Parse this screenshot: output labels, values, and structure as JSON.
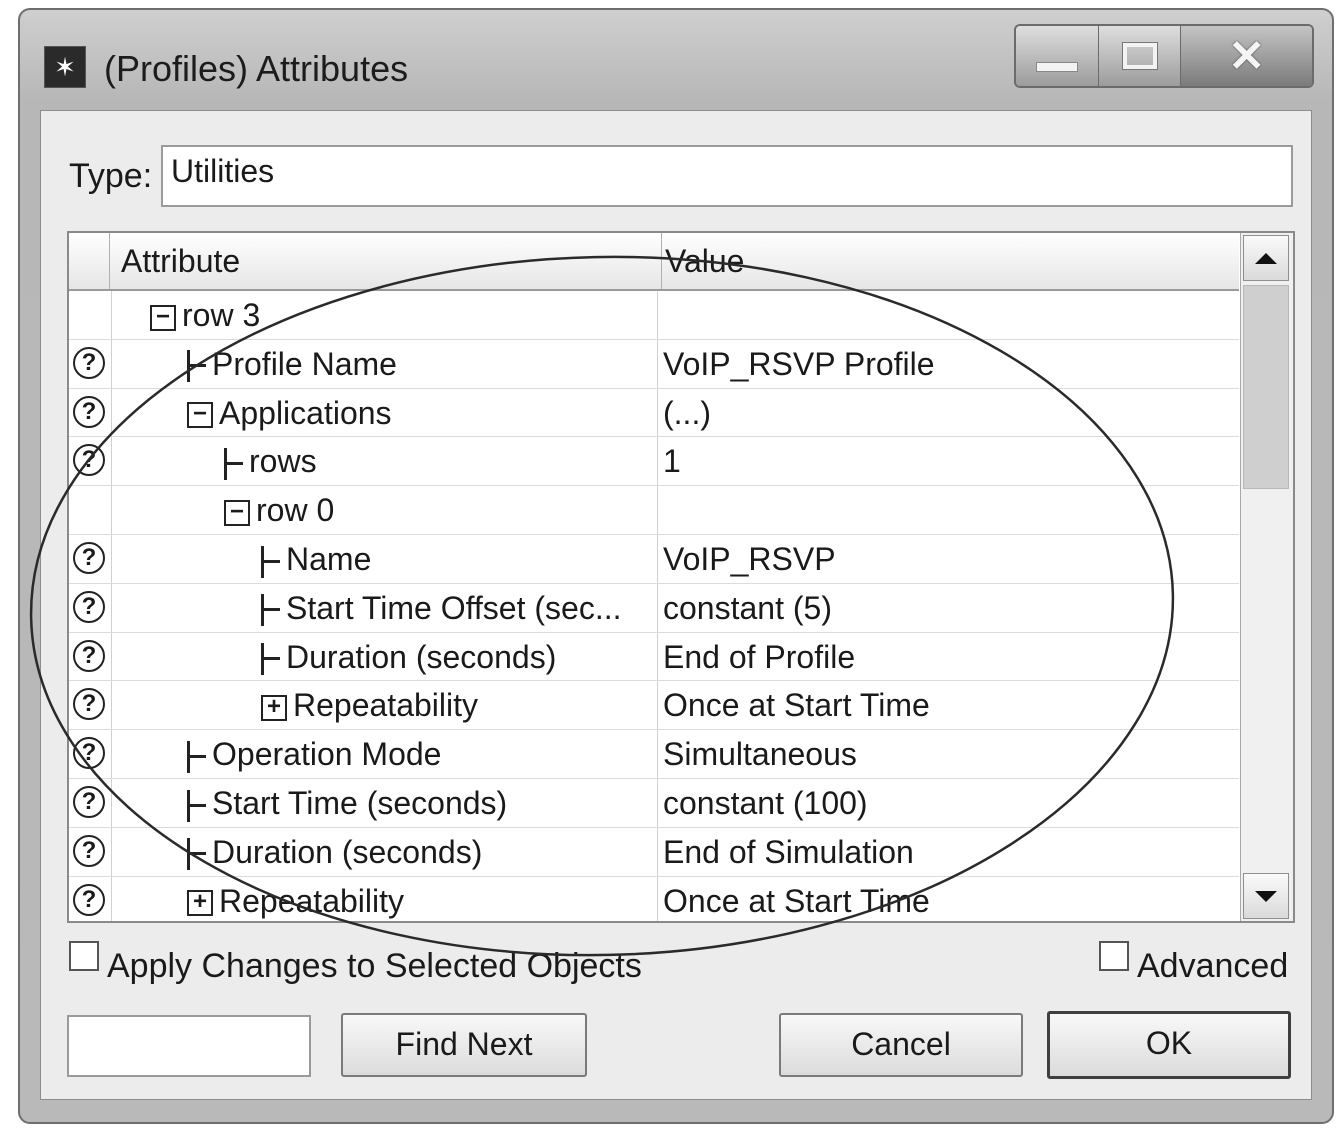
{
  "window": {
    "title": "(Profiles) Attributes",
    "icon": "app-star-icon",
    "controls": [
      "minimize-icon",
      "maximize-icon",
      "close-icon"
    ]
  },
  "type": {
    "label": "Type:",
    "value": "Utilities"
  },
  "grid": {
    "columns": {
      "attribute": "Attribute",
      "value": "Value"
    },
    "rows": [
      {
        "attr": "row 3",
        "value": "",
        "help": false,
        "expander": "−",
        "connector": false,
        "indent": 1
      },
      {
        "attr": "Profile Name",
        "value": "VoIP_RSVP Profile",
        "help": true,
        "expander": "",
        "connector": true,
        "indent": 2
      },
      {
        "attr": "Applications",
        "value": "(...)",
        "help": true,
        "expander": "−",
        "connector": false,
        "indent": 2
      },
      {
        "attr": "rows",
        "value": "1",
        "help": true,
        "expander": "",
        "connector": true,
        "indent": 3
      },
      {
        "attr": "row 0",
        "value": "",
        "help": false,
        "expander": "−",
        "connector": false,
        "indent": 3
      },
      {
        "attr": "Name",
        "value": "VoIP_RSVP",
        "help": true,
        "expander": "",
        "connector": true,
        "indent": 4
      },
      {
        "attr": "Start Time Offset (sec...",
        "value": "constant (5)",
        "help": true,
        "expander": "",
        "connector": true,
        "indent": 4
      },
      {
        "attr": "Duration (seconds)",
        "value": "End of Profile",
        "help": true,
        "expander": "",
        "connector": true,
        "indent": 4
      },
      {
        "attr": "Repeatability",
        "value": "Once at Start Time",
        "help": true,
        "expander": "+",
        "connector": false,
        "indent": 4
      },
      {
        "attr": "Operation Mode",
        "value": "Simultaneous",
        "help": true,
        "expander": "",
        "connector": true,
        "indent": 2
      },
      {
        "attr": "Start Time (seconds)",
        "value": "constant (100)",
        "help": true,
        "expander": "",
        "connector": true,
        "indent": 2
      },
      {
        "attr": "Duration (seconds)",
        "value": "End of Simulation",
        "help": true,
        "expander": "",
        "connector": true,
        "indent": 2
      },
      {
        "attr": "Repeatability",
        "value": "Once at Start Time",
        "help": true,
        "expander": "+",
        "connector": false,
        "indent": 2
      }
    ],
    "help_glyph": "?",
    "scrollbar": {
      "up_icon": "scroll-up-arrow-icon",
      "down_icon": "scroll-down-arrow-icon"
    }
  },
  "options": {
    "apply_changes": {
      "label": "Apply Changes to Selected Objects",
      "checked": false
    },
    "advanced": {
      "label": "Advanced",
      "checked": false
    }
  },
  "buttons": {
    "find_next": "Find Next",
    "cancel": "Cancel",
    "ok": "OK"
  },
  "find_field": {
    "value": ""
  },
  "annotation": {
    "shape": "hand-drawn ellipse",
    "color": "#2a2a2a"
  }
}
